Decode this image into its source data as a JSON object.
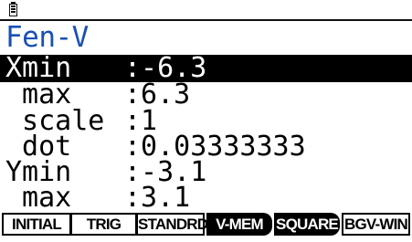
{
  "title": "Fen-V",
  "fields": [
    {
      "label": "Xmin",
      "value": ":-6.3"
    },
    {
      "label": " max",
      "value": ":6.3"
    },
    {
      "label": " scale",
      "value": ":1"
    },
    {
      "label": " dot",
      "value": ":0.03333333"
    },
    {
      "label": "Ymin",
      "value": ":-3.1"
    },
    {
      "label": " max",
      "value": ":3.1"
    }
  ],
  "selected_field": "Xmin",
  "softkeys": [
    {
      "label": "INITIAL",
      "style": "outline"
    },
    {
      "label": "TRIG",
      "style": "outline"
    },
    {
      "label": "STANDRD",
      "style": "outline"
    },
    {
      "label": "V-MEM",
      "style": "filled"
    },
    {
      "label": "SQUARE",
      "style": "filled"
    },
    {
      "label": "BGV-WIN",
      "style": "outline"
    }
  ],
  "colors": {
    "title": "#1a4fb5",
    "foreground": "#000000",
    "background": "#ffffff"
  },
  "icons": {
    "status": "battery-icon"
  }
}
